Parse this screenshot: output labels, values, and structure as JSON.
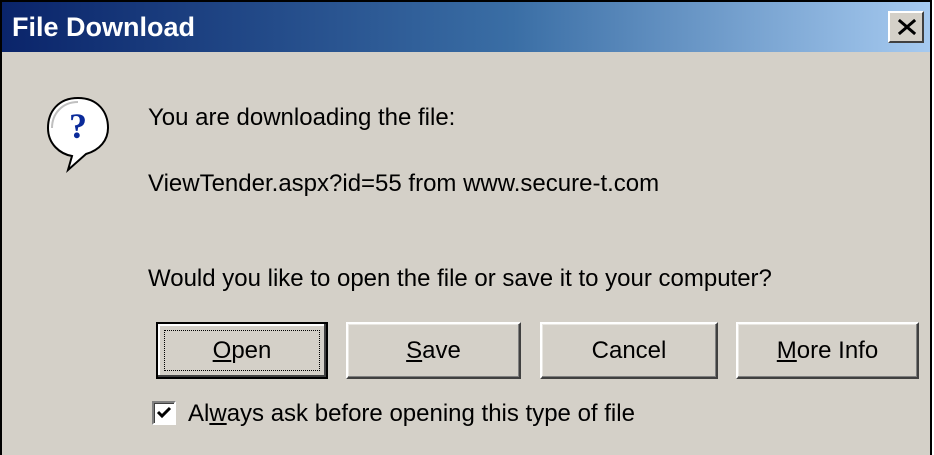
{
  "window": {
    "title": "File Download",
    "close_glyph": "×"
  },
  "icon": {
    "name": "question-icon",
    "glyph": "?",
    "color": "#0a2a9a"
  },
  "message": {
    "line1": "You are downloading the file:",
    "line2": "ViewTender.aspx?id=55 from www.secure-t.com",
    "line3": "Would you like to open the file or save it to your computer?"
  },
  "buttons": {
    "open": {
      "mnemonic": "O",
      "rest": "pen"
    },
    "save": {
      "mnemonic": "S",
      "rest": "ave"
    },
    "cancel": {
      "label": "Cancel"
    },
    "more_info": {
      "mnemonic": "M",
      "rest": "ore Info"
    }
  },
  "checkbox": {
    "checked": true,
    "label_pre": "Al",
    "label_mnemonic": "w",
    "label_post": "ays ask before opening this type of file"
  },
  "colors": {
    "titlebar_start": "#0a246a",
    "titlebar_end": "#a6caf0",
    "face": "#d4d0c8"
  }
}
